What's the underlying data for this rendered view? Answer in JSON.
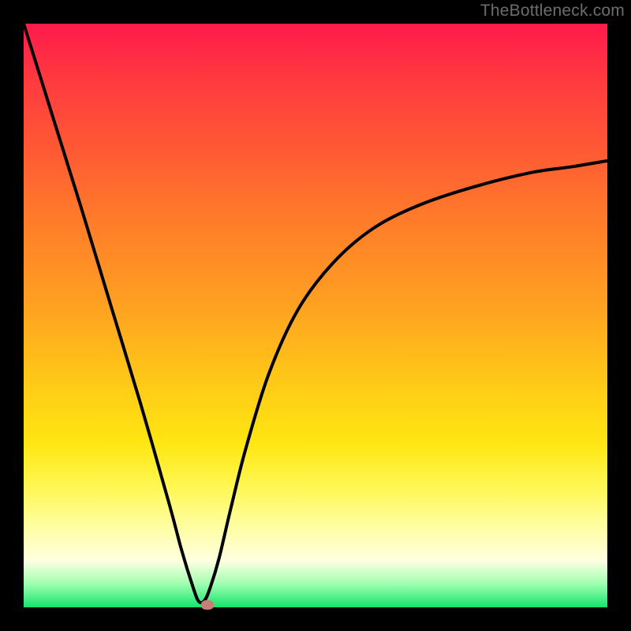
{
  "watermark": "TheBottleneck.com",
  "chart_data": {
    "type": "line",
    "title": "",
    "xlabel": "",
    "ylabel": "",
    "xlim": [
      0,
      1
    ],
    "ylim": [
      0,
      1
    ],
    "series": [
      {
        "name": "curve",
        "x": [
          0.0,
          0.05,
          0.1,
          0.15,
          0.2,
          0.25,
          0.27,
          0.29,
          0.3,
          0.31,
          0.32,
          0.335,
          0.355,
          0.38,
          0.42,
          0.47,
          0.53,
          0.6,
          0.68,
          0.77,
          0.87,
          0.94,
          1.0
        ],
        "y": [
          1.0,
          0.84,
          0.68,
          0.515,
          0.35,
          0.175,
          0.1,
          0.035,
          0.01,
          0.012,
          0.035,
          0.085,
          0.17,
          0.27,
          0.4,
          0.51,
          0.59,
          0.65,
          0.69,
          0.72,
          0.745,
          0.755,
          0.765
        ]
      }
    ],
    "marker": {
      "x": 0.315,
      "y": 0.0
    },
    "gradient_stops": [
      {
        "pos": 0.0,
        "color": "#ff1a4a"
      },
      {
        "pos": 0.5,
        "color": "#ffc518"
      },
      {
        "pos": 0.92,
        "color": "#ffffe0"
      },
      {
        "pos": 1.0,
        "color": "#14e36e"
      }
    ]
  }
}
